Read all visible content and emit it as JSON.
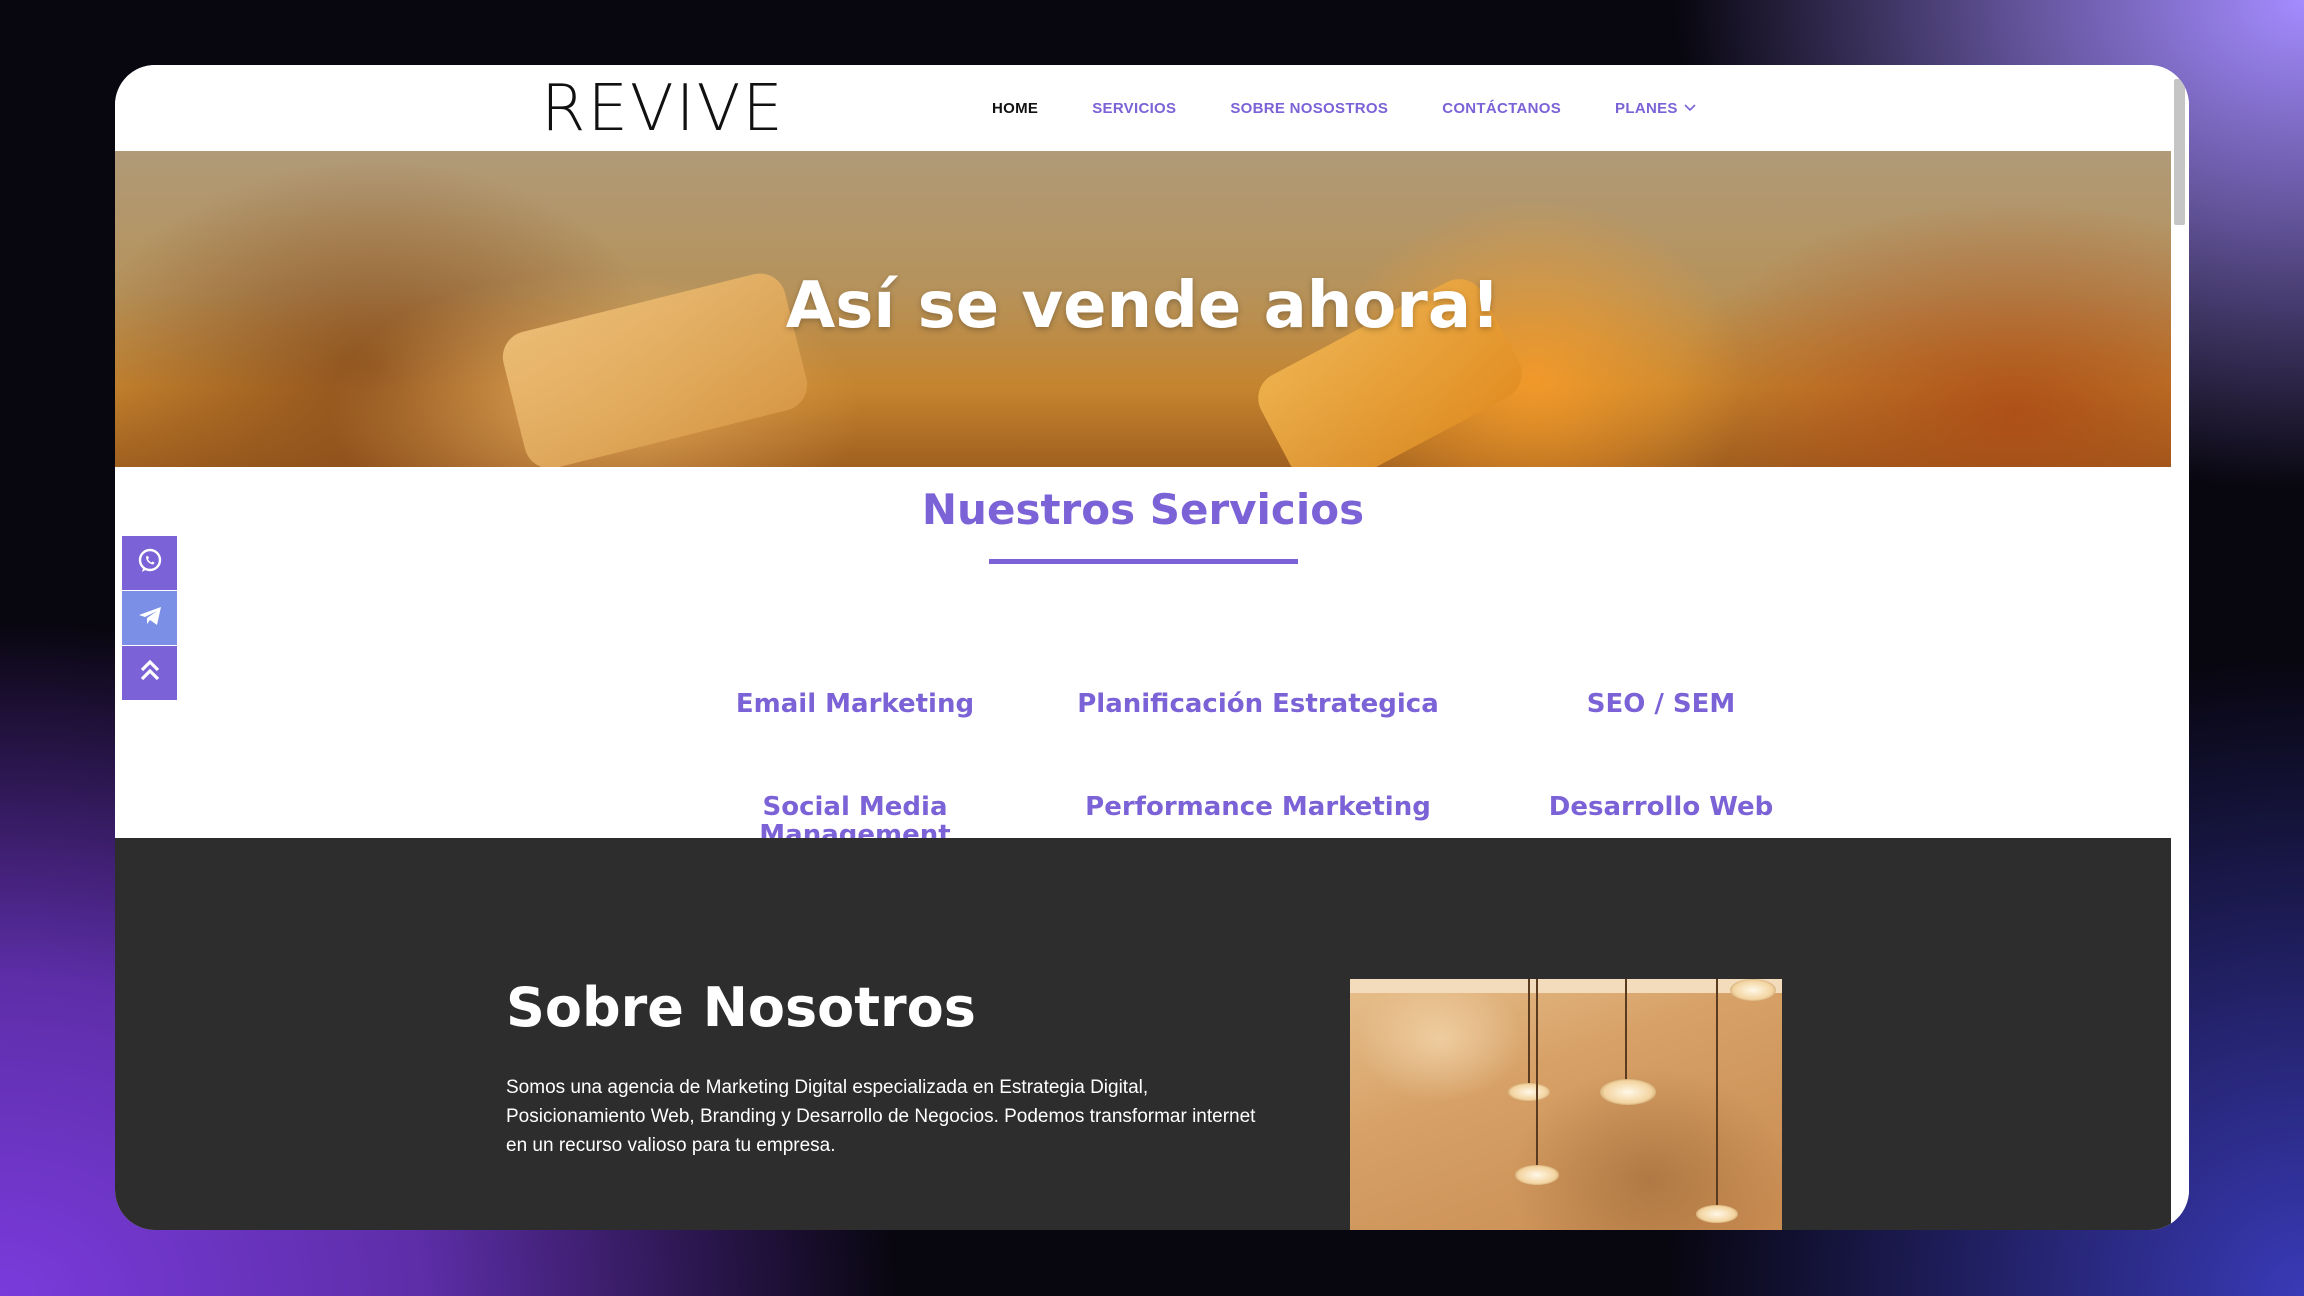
{
  "header": {
    "logo": "REVIVE",
    "nav": [
      {
        "label": "HOME"
      },
      {
        "label": "SERVICIOS"
      },
      {
        "label": "SOBRE NOSOSTROS"
      },
      {
        "label": "CONTÁCTANOS"
      },
      {
        "label": "PLANES"
      }
    ]
  },
  "hero": {
    "title": "Así se vende ahora!"
  },
  "services": {
    "title": "Nuestros Servicios",
    "items": [
      {
        "label": "Email Marketing"
      },
      {
        "label": "Planificación Estrategica"
      },
      {
        "label": "SEO / SEM"
      },
      {
        "label": "Social Media Management"
      },
      {
        "label": "Performance Marketing"
      },
      {
        "label": "Desarrollo Web"
      }
    ]
  },
  "floatbar": {
    "icons": [
      "whatsapp-icon",
      "telegram-icon",
      "chevrons-up-icon"
    ]
  },
  "about": {
    "title": "Sobre Nosotros",
    "text": "Somos una agencia de Marketing Digital especializada en Estrategia Digital, Posicionamiento Web, Branding y Desarrollo de Negocios. Podemos transformar internet en un recurso valioso para tu empresa."
  },
  "colors": {
    "accent": "#7b62d6",
    "dark": "#2d2d2d",
    "telegram": "#7b8fe6"
  }
}
